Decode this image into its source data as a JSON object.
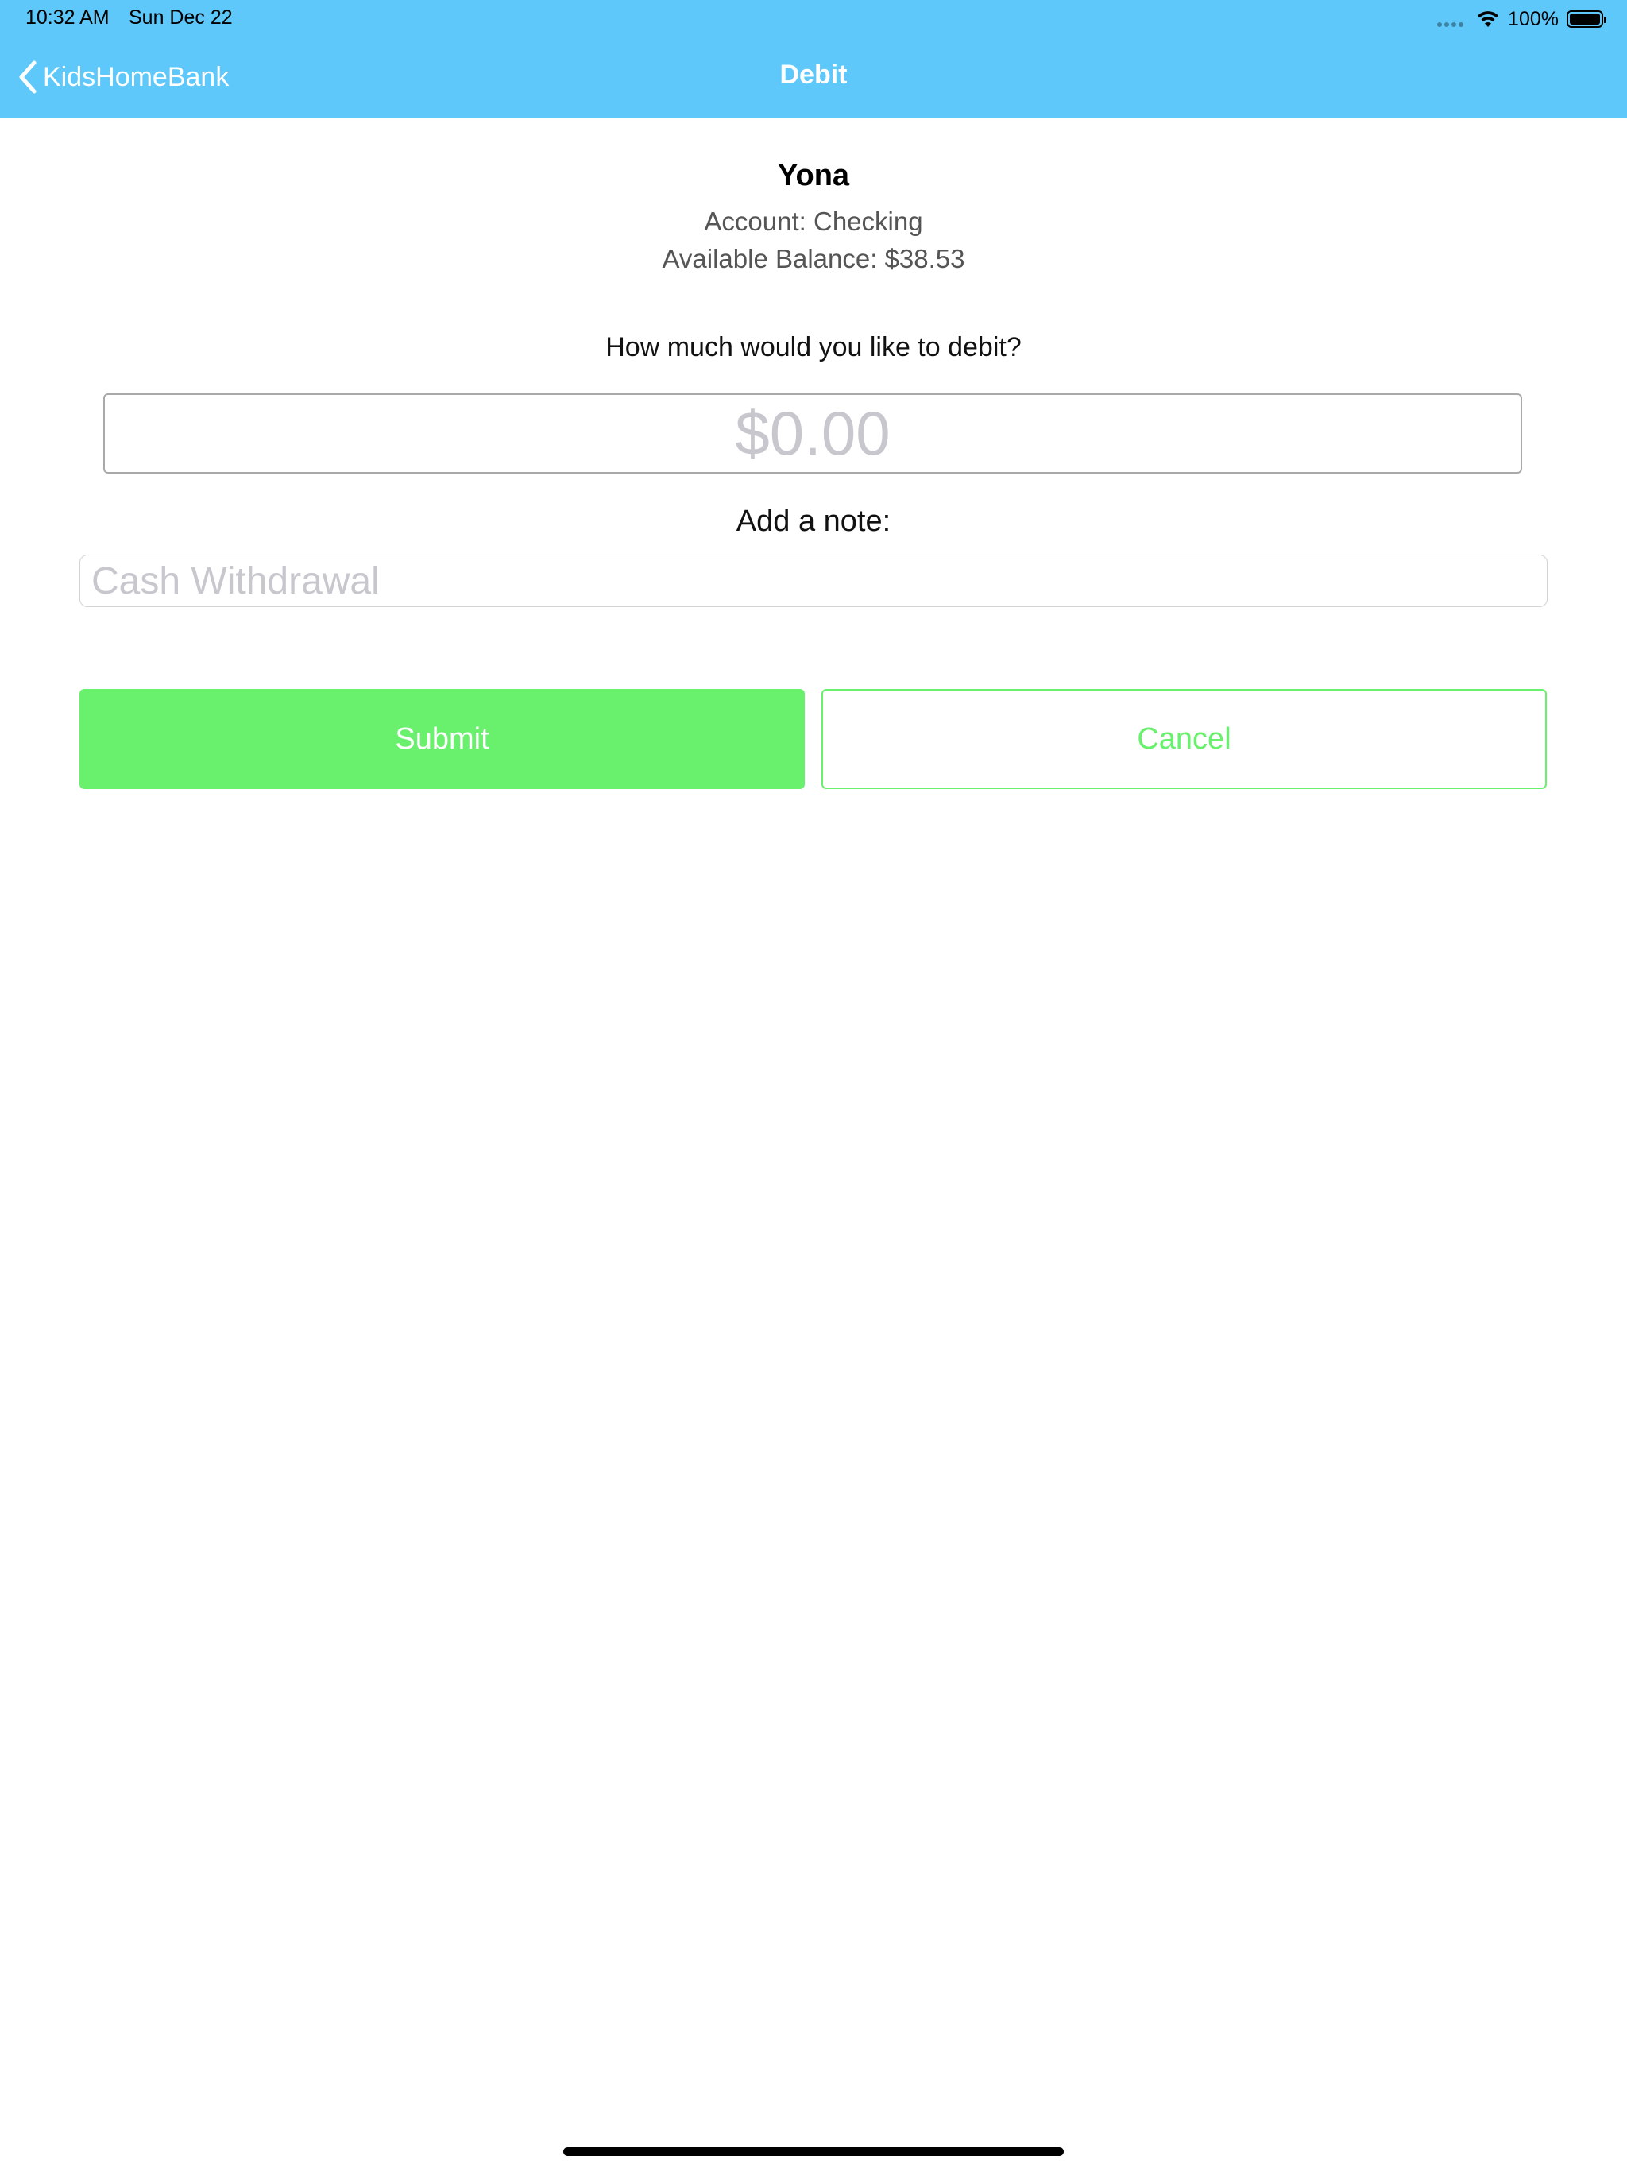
{
  "status_bar": {
    "time": "10:32 AM",
    "date": "Sun Dec 22",
    "battery": "100%",
    "icons": [
      "signal-dots-icon",
      "wifi-icon",
      "battery-icon"
    ]
  },
  "nav": {
    "back_label": "KidsHomeBank",
    "back_icon": "chevron-left-icon",
    "title": "Debit",
    "bar_color": "#5ec8fa"
  },
  "account": {
    "child_name": "Yona",
    "account_line": "Account: Checking",
    "balance_line": "Available Balance: $38.53"
  },
  "form": {
    "question": "How much would you like to debit?",
    "amount_placeholder": "$0.00",
    "amount_value": "",
    "note_label": "Add a note:",
    "note_placeholder": "Cash Withdrawal",
    "note_value": ""
  },
  "actions": {
    "submit_label": "Submit",
    "cancel_label": "Cancel",
    "accent_color": "#69f16d"
  }
}
